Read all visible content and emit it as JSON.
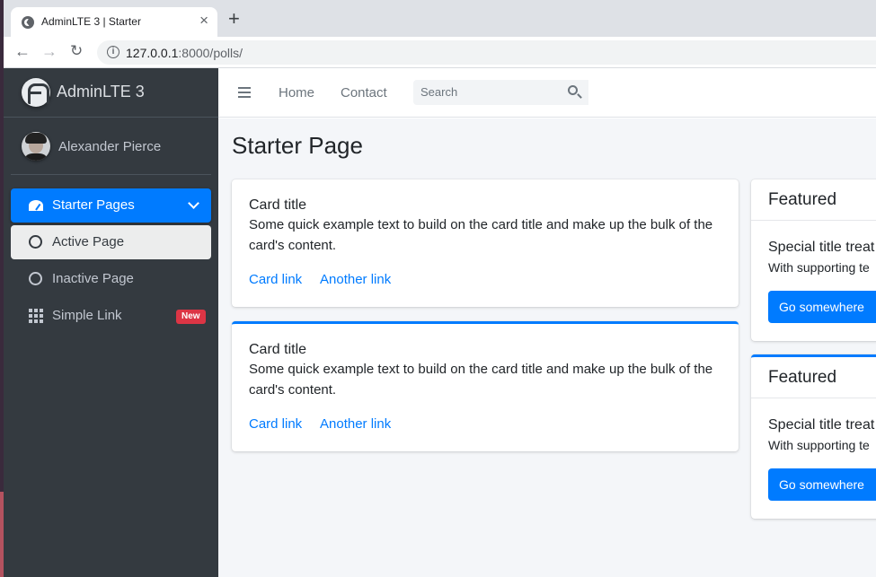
{
  "browser": {
    "tab_title": "AdminLTE 3 | Starter",
    "tab_close": "×",
    "new_tab": "+",
    "url_host": "127.0.0.1",
    "url_rest": ":8000/polls/",
    "back_glyph": "←",
    "forward_glyph": "→",
    "reload_glyph": "↻"
  },
  "sidebar": {
    "brand": "AdminLTE 3",
    "user_name": "Alexander Pierce",
    "items": [
      {
        "label": "Starter Pages",
        "icon": "tachometer-icon",
        "state": "open"
      },
      {
        "label": "Active Page",
        "icon": "circle-icon",
        "state": "active"
      },
      {
        "label": "Inactive Page",
        "icon": "circle-icon",
        "state": "inactive"
      },
      {
        "label": "Simple Link",
        "icon": "grid-icon",
        "badge": "New"
      }
    ]
  },
  "topnav": {
    "home": "Home",
    "contact": "Contact",
    "search_placeholder": "Search"
  },
  "main": {
    "page_title": "Starter Page",
    "cards": [
      {
        "title": "Card title",
        "text": "Some quick example text to build on the card title and make up the bulk of the card's content.",
        "link1": "Card link",
        "link2": "Another link"
      },
      {
        "title": "Card title",
        "text": "Some quick example text to build on the card title and make up the bulk of the card's content.",
        "link1": "Card link",
        "link2": "Another link"
      }
    ],
    "featured": [
      {
        "header": "Featured",
        "title": "Special title treat",
        "text": "With supporting te",
        "button": "Go somewhere"
      },
      {
        "header": "Featured",
        "title": "Special title treat",
        "text": "With supporting te",
        "button": "Go somewhere"
      }
    ]
  },
  "colors": {
    "primary": "#007bff",
    "sidebar_bg": "#343a40",
    "badge_danger": "#dc3545",
    "content_bg": "#f4f6f9"
  }
}
